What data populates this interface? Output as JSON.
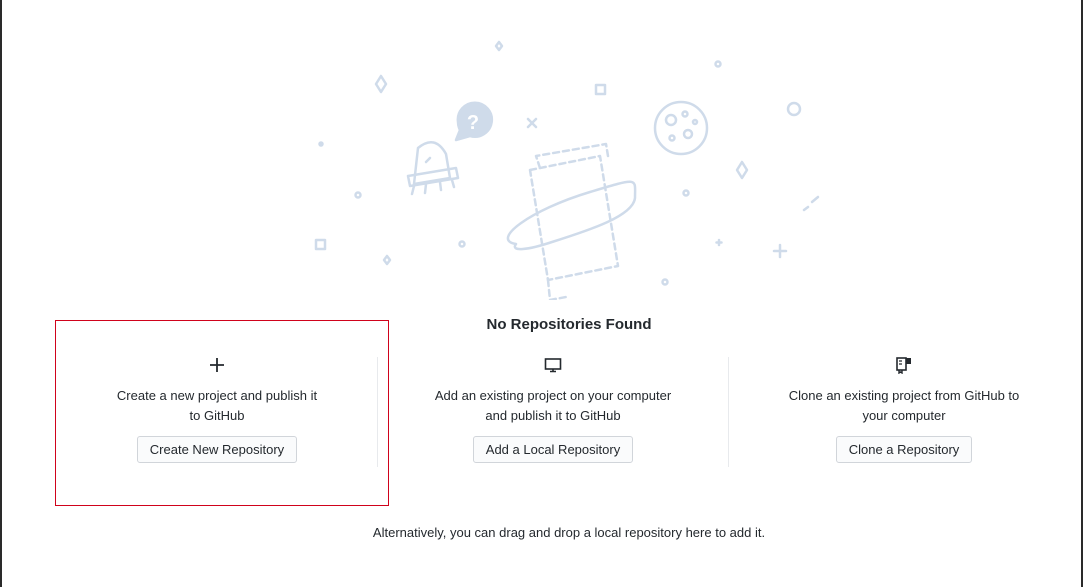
{
  "colors": {
    "illustration": "#cfdbea",
    "highlight_border": "#d0021b",
    "button_bg": "#fafbfc",
    "button_border": "#d1d5da",
    "text": "#24292e"
  },
  "heading": "No Repositories Found",
  "actions": [
    {
      "icon": "plus-icon",
      "description_line1": "Create a new project and publish it",
      "description_line2": "to GitHub",
      "button_label": "Create New Repository"
    },
    {
      "icon": "desktop-icon",
      "description_line1": "Add an existing project on your computer",
      "description_line2": "and publish it to GitHub",
      "button_label": "Add a Local Repository"
    },
    {
      "icon": "clone-repo-icon",
      "description_line1": "Clone an existing project from GitHub to",
      "description_line2": "your computer",
      "button_label": "Clone a Repository"
    }
  ],
  "footer_text": "Alternatively, you can drag and drop a local repository here to add it.",
  "illustration": {
    "speech_bubble_symbol": "?"
  }
}
